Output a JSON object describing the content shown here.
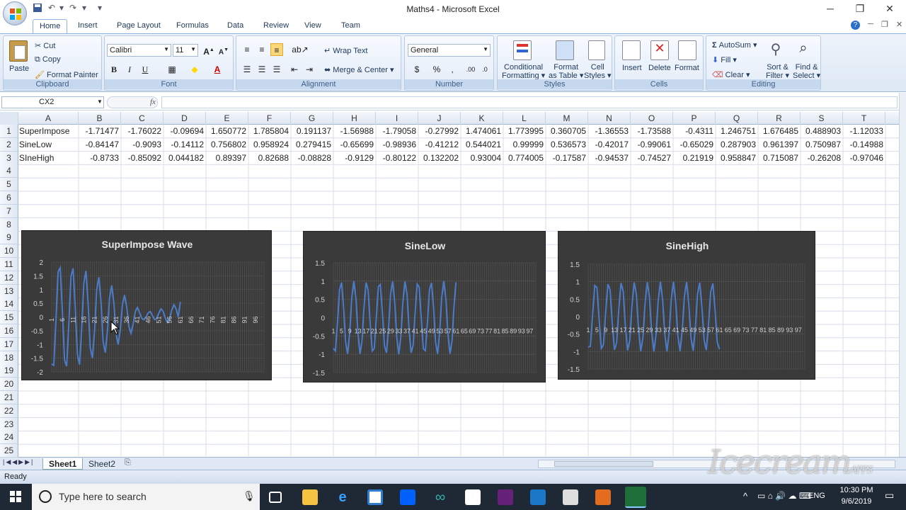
{
  "window": {
    "title": "Maths4 - Microsoft Excel"
  },
  "ribbon": {
    "tabs": [
      "Home",
      "Insert",
      "Page Layout",
      "Formulas",
      "Data",
      "Review",
      "View",
      "Team"
    ],
    "clipboard": {
      "paste": "Paste",
      "cut": "Cut",
      "copy": "Copy",
      "format_painter": "Format Painter",
      "title": "Clipboard"
    },
    "font": {
      "name": "Calibri",
      "size": "11",
      "title": "Font",
      "bold": "B",
      "italic": "I",
      "underline": "U"
    },
    "alignment": {
      "wrap": "Wrap Text",
      "merge": "Merge & Center",
      "title": "Alignment"
    },
    "number": {
      "format": "General",
      "currency": "$",
      "percent": "%",
      "comma": ",",
      "title": "Number"
    },
    "styles": {
      "conditional": "Conditional",
      "formatting": "Formatting",
      "format_as": "Format",
      "as_table": "as Table",
      "cell": "Cell",
      "cell_styles": "Styles",
      "title": "Styles"
    },
    "cells": {
      "insert": "Insert",
      "delete": "Delete",
      "format": "Format",
      "title": "Cells"
    },
    "editing": {
      "autosum": "AutoSum",
      "fill": "Fill",
      "clear": "Clear",
      "sort": "Sort &",
      "filter": "Filter",
      "find": "Find &",
      "select": "Select",
      "title": "Editing"
    }
  },
  "formula_bar": {
    "name_box": "CX2",
    "fx": "fx",
    "formula": ""
  },
  "grid": {
    "columns": [
      "A",
      "B",
      "C",
      "D",
      "E",
      "F",
      "G",
      "H",
      "I",
      "J",
      "K",
      "L",
      "M",
      "N",
      "O",
      "P",
      "Q",
      "R",
      "S",
      "T"
    ],
    "rows": [
      "1",
      "2",
      "3",
      "4",
      "5",
      "6",
      "7",
      "8",
      "9",
      "10",
      "11",
      "12",
      "13",
      "14",
      "15",
      "16",
      "17",
      "18",
      "19",
      "20",
      "21",
      "22",
      "23",
      "24",
      "25"
    ],
    "data": [
      [
        "SuperImpose",
        "-1.71477",
        "-1.76022",
        "-0.09694",
        "1.650772",
        "1.785804",
        "0.191137",
        "-1.56988",
        "-1.79058",
        "-0.27992",
        "1.474061",
        "1.773995",
        "0.360705",
        "-1.36553",
        "-1.73588",
        "-0.4311",
        "1.246751",
        "1.676485",
        "0.488903",
        "-1.12033"
      ],
      [
        "SineLow",
        "-0.84147",
        "-0.9093",
        "-0.14112",
        "0.756802",
        "0.958924",
        "0.279415",
        "-0.65699",
        "-0.98936",
        "-0.41212",
        "0.544021",
        "0.99999",
        "0.536573",
        "-0.42017",
        "-0.99061",
        "-0.65029",
        "0.287903",
        "0.961397",
        "0.750987",
        "-0.14988"
      ],
      [
        "SIneHigh",
        "-0.8733",
        "-0.85092",
        "0.044182",
        "0.89397",
        "0.82688",
        "-0.08828",
        "-0.9129",
        "-0.80122",
        "0.132202",
        "0.93004",
        "0.774005",
        "-0.17587",
        "-0.94537",
        "-0.74527",
        "0.21919",
        "0.958847",
        "0.715087",
        "-0.26208",
        "-0.97046"
      ]
    ]
  },
  "chart_data": [
    {
      "type": "line",
      "title": "SuperImpose Wave",
      "ylim": [
        -2,
        2
      ],
      "yticks": [
        "2",
        "1.5",
        "1",
        "0.5",
        "0",
        "-0.5",
        "-1",
        "-1.5",
        "-2"
      ],
      "xticks": [
        "1",
        "6",
        "11",
        "16",
        "21",
        "26",
        "31",
        "36",
        "41",
        "46",
        "51",
        "56",
        "61",
        "66",
        "71",
        "76",
        "81",
        "86",
        "91",
        "96"
      ],
      "series": [
        {
          "values": [
            -1.71,
            -1.76,
            -0.1,
            1.65,
            1.79,
            0.19,
            -1.57,
            -1.79,
            -0.28,
            1.47,
            1.77,
            0.36,
            -1.37,
            -1.74,
            -0.43,
            1.25,
            1.68,
            0.49,
            -1.12,
            -1.5,
            -0.5,
            1.0,
            1.45,
            0.55,
            -0.9,
            -1.3,
            -0.5,
            0.7,
            1.15,
            0.5,
            -0.6,
            -1.0,
            -0.45,
            0.45,
            0.8,
            0.35,
            -0.35,
            -0.6,
            -0.25,
            0.2,
            0.35,
            0.15,
            -0.05,
            -0.1,
            0.0,
            0.15,
            0.2,
            0.05,
            -0.1,
            -0.05,
            0.15,
            0.3,
            0.2,
            -0.05,
            -0.2,
            -0.05,
            0.25,
            0.45,
            0.3,
            0.0,
            0.55
          ]
        }
      ],
      "grid": true
    },
    {
      "type": "line",
      "title": "SineLow",
      "ylim": [
        -1.5,
        1.5
      ],
      "yticks": [
        "1.5",
        "1",
        "0.5",
        "0",
        "-0.5",
        "-1",
        "-1.5"
      ],
      "xticks": [
        "1",
        "5",
        "9",
        "13",
        "17",
        "21",
        "25",
        "29",
        "33",
        "37",
        "41",
        "45",
        "49",
        "53",
        "57",
        "61",
        "65",
        "69",
        "73",
        "77",
        "81",
        "85",
        "89",
        "93",
        "97"
      ],
      "series": [
        {
          "values": [
            -0.84,
            -0.91,
            -0.14,
            0.76,
            0.96,
            0.28,
            -0.66,
            -0.99,
            -0.41,
            0.54,
            1.0,
            0.54,
            -0.42,
            -0.99,
            -0.65,
            0.29,
            0.96,
            0.75,
            -0.15,
            -0.91,
            -0.84,
            0.01,
            0.85,
            0.91,
            0.13,
            -0.76,
            -0.96,
            -0.27,
            0.66,
            0.99,
            0.41,
            -0.55,
            -1.0,
            -0.53,
            0.42,
            0.99,
            0.65,
            -0.3,
            -0.96,
            -0.75,
            0.16,
            0.92,
            0.83,
            -0.02,
            -0.85,
            -0.9,
            -0.12,
            0.77,
            0.95,
            0.26,
            -0.67,
            -0.99,
            -0.4,
            0.56,
            1.0,
            0.52,
            -0.44,
            -0.99,
            -0.64,
            0.31,
            0.97
          ]
        }
      ],
      "grid": true
    },
    {
      "type": "line",
      "title": "SineHigh",
      "ylim": [
        -1.5,
        1.5
      ],
      "yticks": [
        "1.5",
        "1",
        "0.5",
        "0",
        "-0.5",
        "-1",
        "-1.5"
      ],
      "xticks": [
        "1",
        "5",
        "9",
        "13",
        "17",
        "21",
        "25",
        "29",
        "33",
        "37",
        "41",
        "45",
        "49",
        "53",
        "57",
        "61",
        "65",
        "69",
        "73",
        "77",
        "81",
        "85",
        "89",
        "93",
        "97"
      ],
      "series": [
        {
          "values": [
            -0.87,
            -0.85,
            0.04,
            0.89,
            0.83,
            -0.09,
            -0.91,
            -0.8,
            0.13,
            0.93,
            0.77,
            -0.18,
            -0.95,
            -0.75,
            0.22,
            0.96,
            0.72,
            -0.26,
            -0.97,
            -0.68,
            0.3,
            0.98,
            0.65,
            -0.34,
            -0.99,
            -0.61,
            0.38,
            0.99,
            0.57,
            -0.42,
            -1.0,
            -0.53,
            0.45,
            1.0,
            0.5,
            -0.49,
            -1.0,
            -0.46,
            0.52,
            1.0,
            0.42,
            -0.56,
            -0.99,
            -0.38,
            0.59,
            0.99,
            0.34,
            -0.62,
            -0.98,
            -0.3,
            0.65,
            0.97,
            0.26,
            -0.68,
            -0.96,
            -0.22,
            0.71,
            0.95,
            0.18,
            -0.74,
            -0.93
          ]
        }
      ],
      "grid": true
    }
  ],
  "sheets": [
    "Sheet1",
    "Sheet2"
  ],
  "status": {
    "text": "Ready"
  },
  "taskbar": {
    "search_placeholder": "Type here to search",
    "time": "10:30 PM",
    "date": "9/6/2019",
    "lang": "ENG"
  },
  "watermark": "Icecream APPS"
}
